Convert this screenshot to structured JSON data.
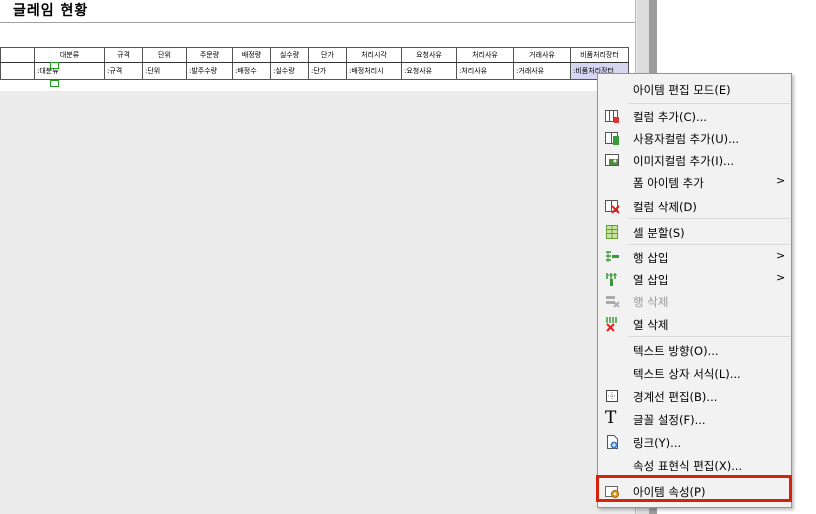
{
  "report": {
    "title": "글레임 현황",
    "headers": [
      "",
      "대분류",
      "규격",
      "단위",
      "주문량",
      "배정량",
      "실수량",
      "단가",
      "처리시각",
      "요청사유",
      "처리사유",
      "거래사유",
      "비품처리장터"
    ],
    "row": [
      "",
      ":대분류",
      ":규격",
      ":단위",
      ":발주수량",
      ":배정수",
      ":실수량",
      ":단가",
      ":배정처리시",
      ":요청사유",
      ":처리사유",
      ":거래사유",
      ":비품처리장터"
    ]
  },
  "context_menu": {
    "items": [
      {
        "label": "아이템 편집 모드(E)",
        "icon": "none"
      },
      {
        "label": "컬럼 추가(C)...",
        "icon": "add-column-icon"
      },
      {
        "label": "사용자컬럼 추가(U)...",
        "icon": "add-user-column-icon"
      },
      {
        "label": "이미지컬럼 추가(I)...",
        "icon": "add-image-column-icon"
      },
      {
        "label": "폼 아이템 추가",
        "icon": "none",
        "submenu": ">"
      },
      {
        "label": "컬럼 삭제(D)",
        "icon": "delete-column-icon"
      },
      {
        "label": "셀 분할(S)",
        "icon": "split-cell-icon"
      },
      {
        "label": "행 삽입",
        "icon": "insert-row-icon",
        "submenu": ">"
      },
      {
        "label": "열 삽입",
        "icon": "insert-column-icon",
        "submenu": ">"
      },
      {
        "label": "행 삭제",
        "icon": "delete-row-icon",
        "disabled": true
      },
      {
        "label": "열 삭제",
        "icon": "delete-column-x-icon"
      },
      {
        "label": "텍스트 방향(O)...",
        "icon": "none"
      },
      {
        "label": "텍스트 상자 서식(L)...",
        "icon": "none"
      },
      {
        "label": "경계선 편집(B)...",
        "icon": "border-edit-icon"
      },
      {
        "label": "글꼴 설정(F)...",
        "icon": "font-icon"
      },
      {
        "label": "링크(Y)...",
        "icon": "link-icon"
      },
      {
        "label": "속성 표현식 편집(X)...",
        "icon": "none"
      },
      {
        "label": "아이템 속성(P)",
        "icon": "item-properties-icon"
      }
    ],
    "colors": {
      "highlight_border": "#d6220a",
      "menu_border": "#6c9ecb"
    }
  }
}
